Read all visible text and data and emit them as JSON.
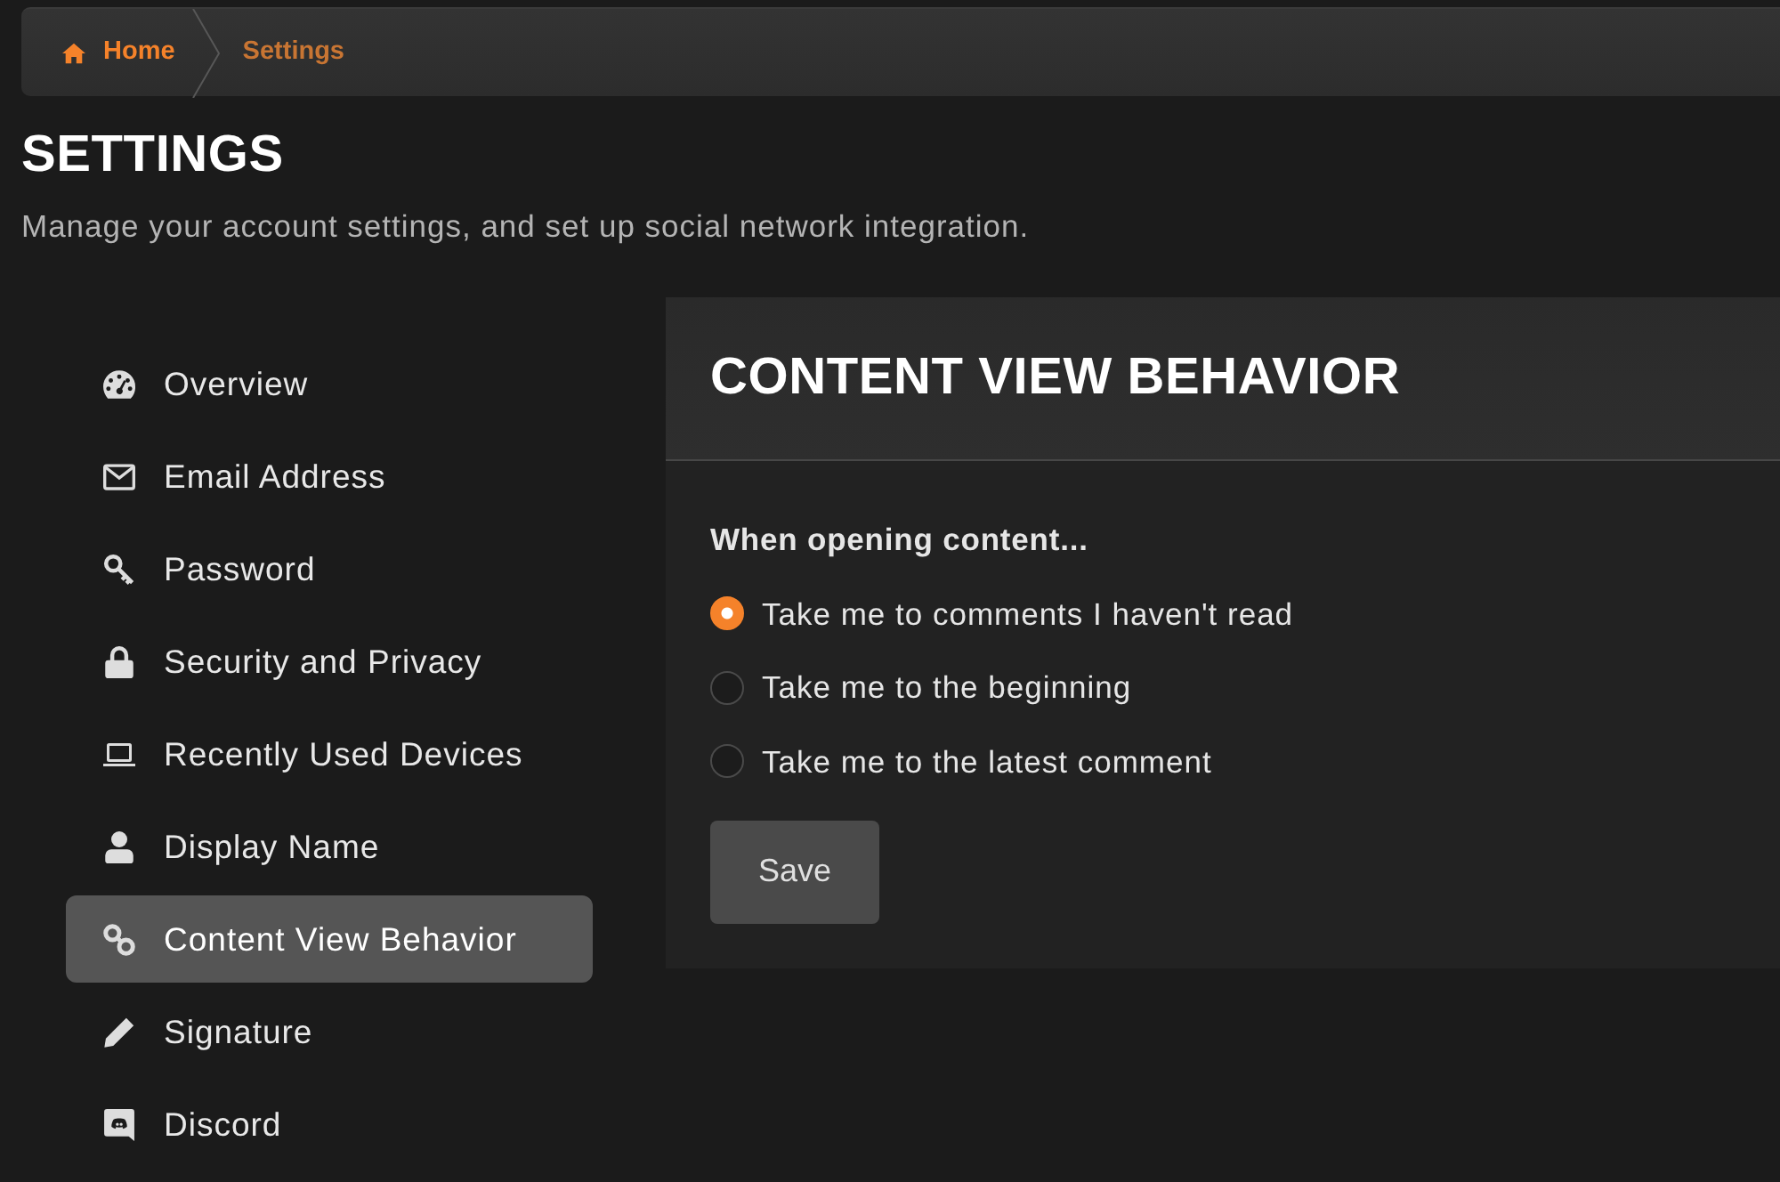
{
  "breadcrumb": [
    {
      "label": "Home",
      "kind": "home"
    },
    {
      "label": "Settings",
      "kind": "current"
    }
  ],
  "page": {
    "title": "SETTINGS",
    "subtitle": "Manage your account settings, and set up social network integration."
  },
  "sidebar": {
    "items": [
      {
        "label": "Overview",
        "selected": false
      },
      {
        "label": "Email Address",
        "selected": false
      },
      {
        "label": "Password",
        "selected": false
      },
      {
        "label": "Security and Privacy",
        "selected": false
      },
      {
        "label": "Recently Used Devices",
        "selected": false
      },
      {
        "label": "Display Name",
        "selected": false
      },
      {
        "label": "Content View Behavior",
        "selected": true
      },
      {
        "label": "Signature",
        "selected": false
      },
      {
        "label": "Discord",
        "selected": false
      }
    ]
  },
  "panel": {
    "title": "CONTENT VIEW BEHAVIOR",
    "question": "When opening content...",
    "options": [
      {
        "label": "Take me to comments I haven't read",
        "selected": true
      },
      {
        "label": "Take me to the beginning",
        "selected": false
      },
      {
        "label": "Take me to the latest comment",
        "selected": false
      }
    ],
    "button": "Save"
  }
}
